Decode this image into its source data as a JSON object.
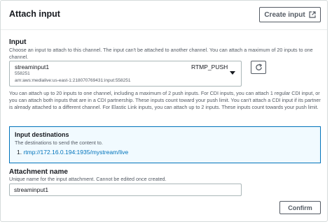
{
  "header": {
    "title": "Attach input",
    "create_button_label": "Create input"
  },
  "input_section": {
    "label": "Input",
    "description": "Choose an input to attach to this channel. The input can't be attached to another channel. You can attach a maximum of 20 inputs to one channel.",
    "selected": {
      "name": "streaminput1",
      "type": "RTMP_PUSH",
      "id": "558251",
      "arn": "arn:aws:medialive:us-east-1:218070769431:input:558251"
    },
    "help_text": "You can attach up to 20 inputs to one channel, including a maximum of 2 push inputs. For CDI inputs, you can attach 1 regular CDI input, or you can attach both inputs that are in a CDI partnership. These inputs count toward your push limit. You can't attach a CDI input if its partner is already attached to a different channel. For Elastic Link inputs, you can attach up to 2 inputs. These inputs count towards your push limit."
  },
  "destinations": {
    "title": "Input destinations",
    "subtitle": "The destinations to send the content to.",
    "items": [
      {
        "index": "1.",
        "url": "rtmp://172.16.0.194:1935/mystream/live"
      }
    ]
  },
  "attachment": {
    "label": "Attachment name",
    "description": "Unique name for the input attachment. Cannot be edited once created.",
    "value": "streaminput1"
  },
  "footer": {
    "confirm_label": "Confirm"
  },
  "colors": {
    "link": "#0073bb",
    "info_bg": "#f1faff",
    "border": "#aab7b8"
  }
}
